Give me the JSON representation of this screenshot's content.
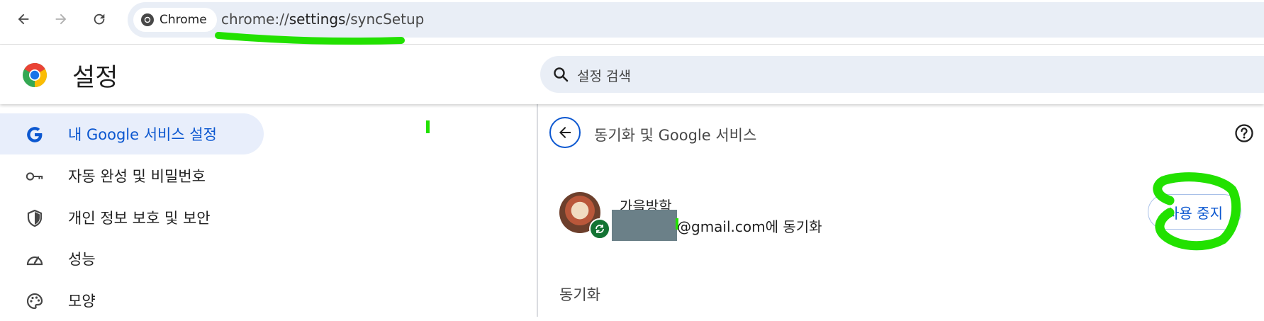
{
  "browser": {
    "chip_label": "Chrome",
    "url_prefix": "chrome://",
    "url_host": "settings",
    "url_path": "/syncSetup",
    "icons": [
      "back-arrow-icon",
      "forward-arrow-icon",
      "reload-icon",
      "chrome-logo-icon"
    ]
  },
  "header": {
    "title": "설정",
    "search_placeholder": "설정 검색"
  },
  "sidebar": {
    "items": [
      {
        "label": "내 Google 서비스 설정",
        "icon": "google-g-icon",
        "active": true
      },
      {
        "label": "자동 완성 및 비밀번호",
        "icon": "key-icon",
        "active": false
      },
      {
        "label": "개인 정보 보호 및 보안",
        "icon": "shield-icon",
        "active": false
      },
      {
        "label": "성능",
        "icon": "speedometer-icon",
        "active": false
      },
      {
        "label": "모양",
        "icon": "palette-icon",
        "active": false
      }
    ]
  },
  "main": {
    "section_title": "동기화 및 Google 서비스",
    "account": {
      "name": "가을방학",
      "email_suffix": "@gmail.com에 동기화"
    },
    "turn_off_label": "사용 중지",
    "sync_heading": "동기화"
  },
  "colors": {
    "accent": "#0b57d0",
    "active_bg": "#e8eefb",
    "omnibox_bg": "#e9eef6",
    "sync_badge": "#137333",
    "annotation": "#22e100",
    "redaction": "#6b8088"
  }
}
